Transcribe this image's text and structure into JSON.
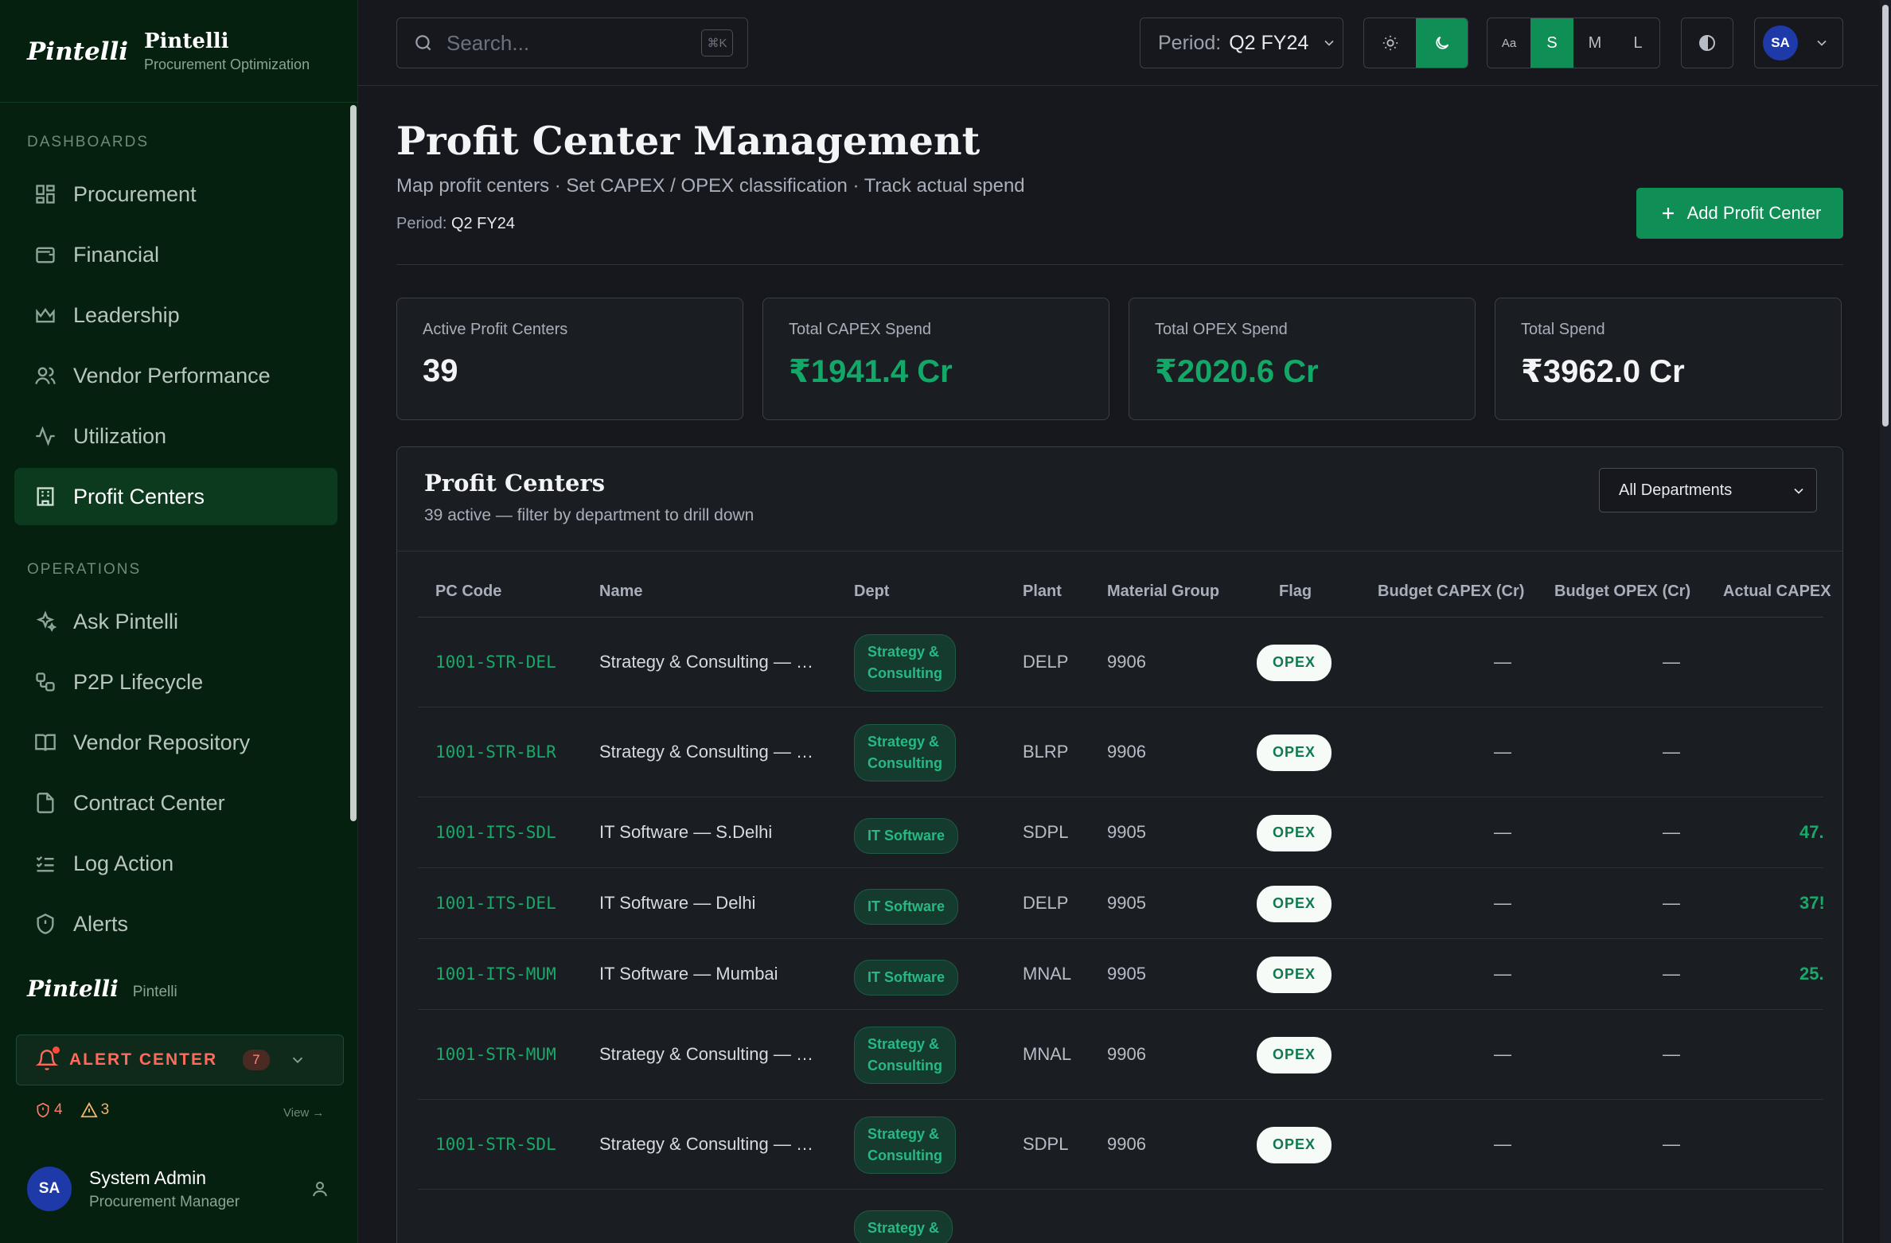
{
  "brand": {
    "logo": "Pintelli",
    "name": "Pintelli",
    "subtitle": "Procurement Optimization"
  },
  "sidebar": {
    "section_dashboards": "DASHBOARDS",
    "dashboards": [
      {
        "label": "Procurement",
        "icon": "grid-icon"
      },
      {
        "label": "Financial",
        "icon": "wallet-icon"
      },
      {
        "label": "Leadership",
        "icon": "crown-icon"
      },
      {
        "label": "Vendor Performance",
        "icon": "users-icon"
      },
      {
        "label": "Utilization",
        "icon": "activity-icon"
      },
      {
        "label": "Profit Centers",
        "icon": "building-icon",
        "active": true
      }
    ],
    "section_operations": "OPERATIONS",
    "operations": [
      {
        "label": "Ask Pintelli",
        "icon": "sparkles-icon"
      },
      {
        "label": "P2P Lifecycle",
        "icon": "workflow-icon"
      },
      {
        "label": "Vendor Repository",
        "icon": "book-icon"
      },
      {
        "label": "Contract Center",
        "icon": "document-icon"
      },
      {
        "label": "Log Action",
        "icon": "list-check-icon"
      },
      {
        "label": "Alerts",
        "icon": "shield-icon"
      }
    ],
    "footer_logo": "Pintelli",
    "footer_name": "Pintelli",
    "alert_center": {
      "label": "ALERT CENTER",
      "count": "7",
      "critical": "4",
      "warning": "3",
      "view": "View →"
    },
    "user": {
      "initials": "SA",
      "name": "System Admin",
      "role": "Procurement Manager"
    }
  },
  "topbar": {
    "search_placeholder": "Search...",
    "shortcut": "⌘K",
    "period_label": "Period:",
    "period_value": "Q2 FY24",
    "size_options": [
      "Aa",
      "S",
      "M",
      "L"
    ],
    "size_selected": "S",
    "theme_selected": "dark",
    "user_initials": "SA"
  },
  "header": {
    "title": "Profit Center Management",
    "subtitle": "Map profit centers · Set CAPEX / OPEX classification · Track actual spend",
    "period_label": "Period:",
    "period_value": "Q2 FY24",
    "add_button": "Add Profit Center"
  },
  "kpis": [
    {
      "label": "Active Profit Centers",
      "value": "39",
      "green": false
    },
    {
      "label": "Total CAPEX Spend",
      "value": "₹1941.4 Cr",
      "green": true
    },
    {
      "label": "Total OPEX Spend",
      "value": "₹2020.6 Cr",
      "green": true
    },
    {
      "label": "Total Spend",
      "value": "₹3962.0 Cr",
      "green": false
    }
  ],
  "table": {
    "title": "Profit Centers",
    "subtitle": "39 active — filter by department to drill down",
    "filter_value": "All Departments",
    "columns": [
      "PC Code",
      "Name",
      "Dept",
      "Plant",
      "Material Group",
      "Flag",
      "Budget CAPEX (Cr)",
      "Budget OPEX (Cr)",
      "Actual CAPEX"
    ],
    "rows": [
      {
        "code": "1001-STR-DEL",
        "name": "Strategy & Consulting — …",
        "dept_line1": "Strategy &",
        "dept_line2": "Consulting",
        "plant": "DELP",
        "material_group": "9906",
        "flag": "OPEX",
        "budget_capex": "—",
        "budget_opex": "—",
        "actual": ""
      },
      {
        "code": "1001-STR-BLR",
        "name": "Strategy & Consulting — …",
        "dept_line1": "Strategy &",
        "dept_line2": "Consulting",
        "plant": "BLRP",
        "material_group": "9906",
        "flag": "OPEX",
        "budget_capex": "—",
        "budget_opex": "—",
        "actual": ""
      },
      {
        "code": "1001-ITS-SDL",
        "name": "IT Software — S.Delhi",
        "dept_line1": "IT Software",
        "dept_line2": "",
        "plant": "SDPL",
        "material_group": "9905",
        "flag": "OPEX",
        "budget_capex": "—",
        "budget_opex": "—",
        "actual": "47."
      },
      {
        "code": "1001-ITS-DEL",
        "name": "IT Software — Delhi",
        "dept_line1": "IT Software",
        "dept_line2": "",
        "plant": "DELP",
        "material_group": "9905",
        "flag": "OPEX",
        "budget_capex": "—",
        "budget_opex": "—",
        "actual": "37!"
      },
      {
        "code": "1001-ITS-MUM",
        "name": "IT Software — Mumbai",
        "dept_line1": "IT Software",
        "dept_line2": "",
        "plant": "MNAL",
        "material_group": "9905",
        "flag": "OPEX",
        "budget_capex": "—",
        "budget_opex": "—",
        "actual": "25."
      },
      {
        "code": "1001-STR-MUM",
        "name": "Strategy & Consulting — …",
        "dept_line1": "Strategy &",
        "dept_line2": "Consulting",
        "plant": "MNAL",
        "material_group": "9906",
        "flag": "OPEX",
        "budget_capex": "—",
        "budget_opex": "—",
        "actual": ""
      },
      {
        "code": "1001-STR-SDL",
        "name": "Strategy & Consulting — …",
        "dept_line1": "Strategy &",
        "dept_line2": "Consulting",
        "plant": "SDPL",
        "material_group": "9906",
        "flag": "OPEX",
        "budget_capex": "—",
        "budget_opex": "—",
        "actual": ""
      },
      {
        "code": "",
        "name": "",
        "dept_line1": "Strategy &",
        "dept_line2": "",
        "plant": "",
        "material_group": "",
        "flag": "",
        "budget_capex": "",
        "budget_opex": "",
        "actual": ""
      }
    ]
  }
}
